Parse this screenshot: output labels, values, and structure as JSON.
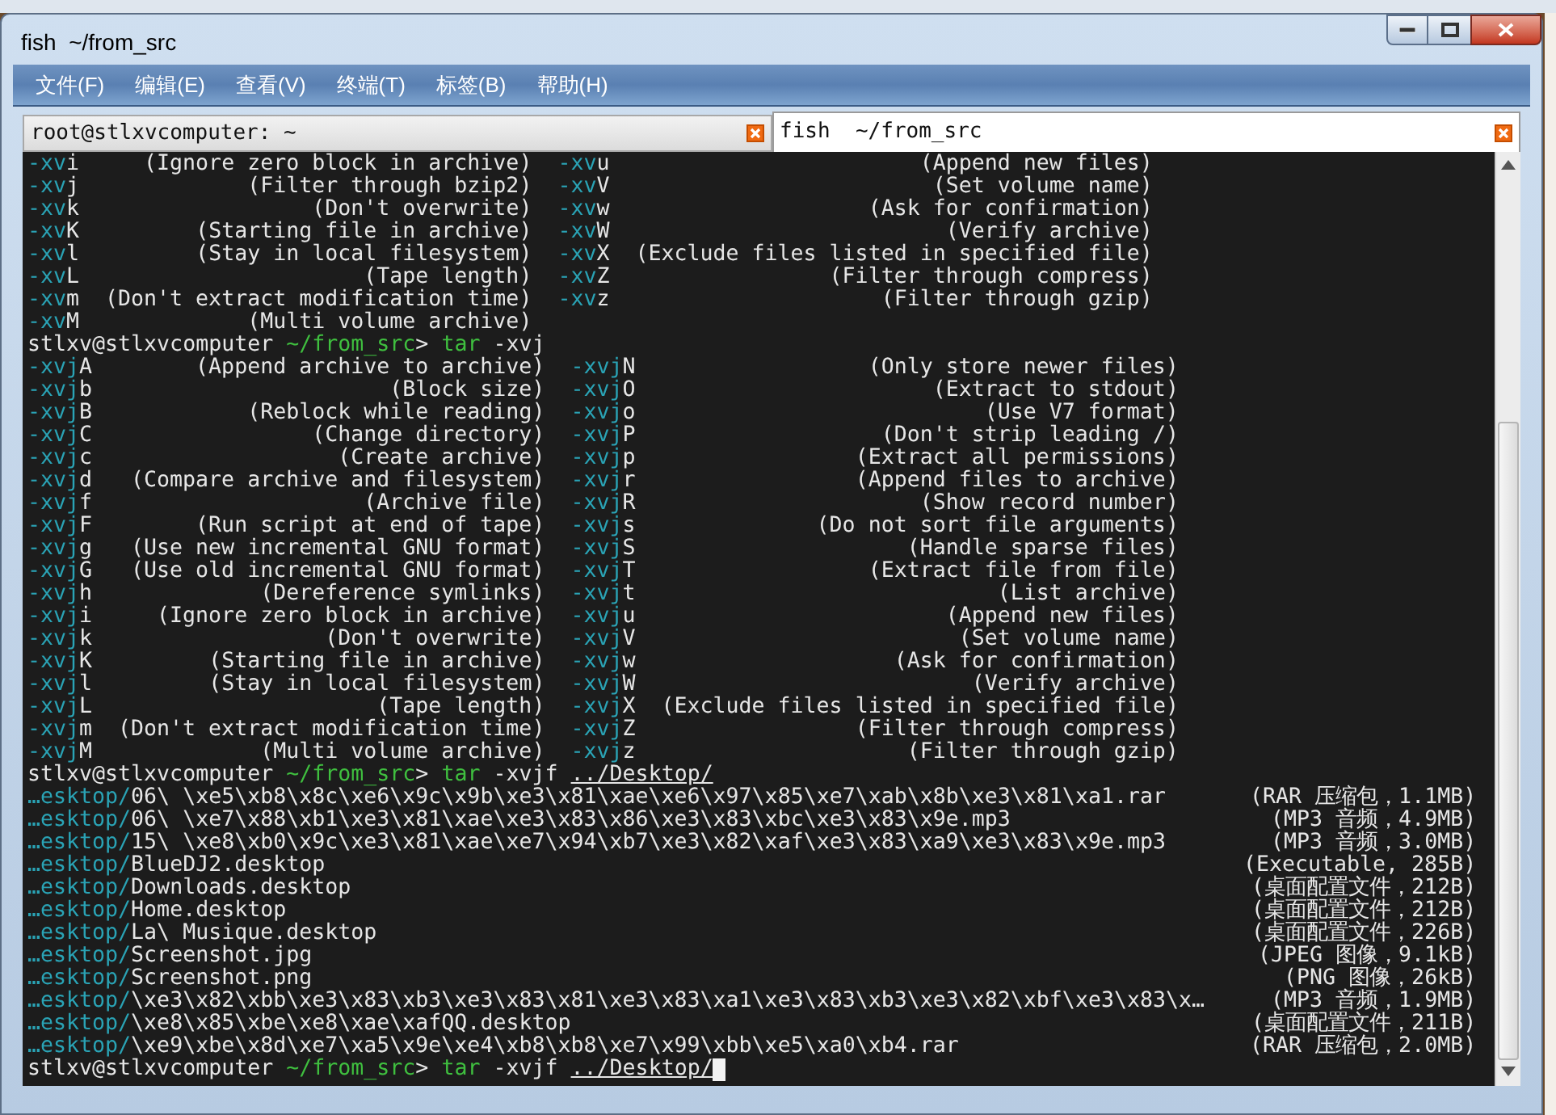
{
  "window": {
    "title": "fish  ~/from_src"
  },
  "menu": [
    {
      "label": "文件(F)"
    },
    {
      "label": "编辑(E)"
    },
    {
      "label": "查看(V)"
    },
    {
      "label": "终端(T)"
    },
    {
      "label": "标签(B)"
    },
    {
      "label": "帮助(H)"
    }
  ],
  "tabs": [
    {
      "label": "root@stlxvcomputer: ~",
      "selected": false
    },
    {
      "label": "fish  ~/from_src",
      "selected": true
    }
  ],
  "terminal": {
    "lines": [
      {
        "kind": "completion",
        "left": {
          "flag": "-xvi",
          "description": "(Ignore zero block in archive)"
        },
        "right": {
          "flag": "-xvu",
          "description": "(Append new files)"
        }
      },
      {
        "kind": "completion",
        "left": {
          "flag": "-xvj",
          "description": "(Filter through bzip2)"
        },
        "right": {
          "flag": "-xvV",
          "description": "(Set volume name)"
        }
      },
      {
        "kind": "completion",
        "left": {
          "flag": "-xvk",
          "description": "(Don't overwrite)"
        },
        "right": {
          "flag": "-xvw",
          "description": "(Ask for confirmation)"
        }
      },
      {
        "kind": "completion",
        "left": {
          "flag": "-xvK",
          "description": "(Starting file in archive)"
        },
        "right": {
          "flag": "-xvW",
          "description": "(Verify archive)"
        }
      },
      {
        "kind": "completion",
        "left": {
          "flag": "-xvl",
          "description": "(Stay in local filesystem)"
        },
        "right": {
          "flag": "-xvX",
          "description": "(Exclude files listed in specified file)"
        }
      },
      {
        "kind": "completion",
        "left": {
          "flag": "-xvL",
          "description": "(Tape length)"
        },
        "right": {
          "flag": "-xvZ",
          "description": "(Filter through compress)"
        }
      },
      {
        "kind": "completion",
        "left": {
          "flag": "-xvm",
          "description": "(Don't extract modification time)"
        },
        "right": {
          "flag": "-xvz",
          "description": "(Filter through gzip)"
        }
      },
      {
        "kind": "completion",
        "left": {
          "flag": "-xvM",
          "description": "(Multi volume archive)"
        }
      },
      {
        "kind": "prompt",
        "user_host": "stlxv@stlxvcomputer",
        "cwd": "~/from_src",
        "symbol": ">",
        "command": "tar",
        "args": "-xvj",
        "cursor": false
      },
      {
        "kind": "completion",
        "left": {
          "flag": "-xvjA",
          "description": "(Append archive to archive)"
        },
        "right": {
          "flag": "-xvjN",
          "description": "(Only store newer files)"
        }
      },
      {
        "kind": "completion",
        "left": {
          "flag": "-xvjb",
          "description": "(Block size)"
        },
        "right": {
          "flag": "-xvjO",
          "description": "(Extract to stdout)"
        }
      },
      {
        "kind": "completion",
        "left": {
          "flag": "-xvjB",
          "description": "(Reblock while reading)"
        },
        "right": {
          "flag": "-xvjo",
          "description": "(Use V7 format)"
        }
      },
      {
        "kind": "completion",
        "left": {
          "flag": "-xvjC",
          "description": "(Change directory)"
        },
        "right": {
          "flag": "-xvjP",
          "description": "(Don't strip leading /)"
        }
      },
      {
        "kind": "completion",
        "left": {
          "flag": "-xvjc",
          "description": "(Create archive)"
        },
        "right": {
          "flag": "-xvjp",
          "description": "(Extract all permissions)"
        }
      },
      {
        "kind": "completion",
        "left": {
          "flag": "-xvjd",
          "description": "(Compare archive and filesystem)"
        },
        "right": {
          "flag": "-xvjr",
          "description": "(Append files to archive)"
        }
      },
      {
        "kind": "completion",
        "left": {
          "flag": "-xvjf",
          "description": "(Archive file)"
        },
        "right": {
          "flag": "-xvjR",
          "description": "(Show record number)"
        }
      },
      {
        "kind": "completion",
        "left": {
          "flag": "-xvjF",
          "description": "(Run script at end of tape)"
        },
        "right": {
          "flag": "-xvjs",
          "description": "(Do not sort file arguments)"
        }
      },
      {
        "kind": "completion",
        "left": {
          "flag": "-xvjg",
          "description": "(Use new incremental GNU format)"
        },
        "right": {
          "flag": "-xvjS",
          "description": "(Handle sparse files)"
        }
      },
      {
        "kind": "completion",
        "left": {
          "flag": "-xvjG",
          "description": "(Use old incremental GNU format)"
        },
        "right": {
          "flag": "-xvjT",
          "description": "(Extract file from file)"
        }
      },
      {
        "kind": "completion",
        "left": {
          "flag": "-xvjh",
          "description": "(Dereference symlinks)"
        },
        "right": {
          "flag": "-xvjt",
          "description": "(List archive)"
        }
      },
      {
        "kind": "completion",
        "left": {
          "flag": "-xvji",
          "description": "(Ignore zero block in archive)"
        },
        "right": {
          "flag": "-xvju",
          "description": "(Append new files)"
        }
      },
      {
        "kind": "completion",
        "left": {
          "flag": "-xvjk",
          "description": "(Don't overwrite)"
        },
        "right": {
          "flag": "-xvjV",
          "description": "(Set volume name)"
        }
      },
      {
        "kind": "completion",
        "left": {
          "flag": "-xvjK",
          "description": "(Starting file in archive)"
        },
        "right": {
          "flag": "-xvjw",
          "description": "(Ask for confirmation)"
        }
      },
      {
        "kind": "completion",
        "left": {
          "flag": "-xvjl",
          "description": "(Stay in local filesystem)"
        },
        "right": {
          "flag": "-xvjW",
          "description": "(Verify archive)"
        }
      },
      {
        "kind": "completion",
        "left": {
          "flag": "-xvjL",
          "description": "(Tape length)"
        },
        "right": {
          "flag": "-xvjX",
          "description": "(Exclude files listed in specified file)"
        }
      },
      {
        "kind": "completion",
        "left": {
          "flag": "-xvjm",
          "description": "(Don't extract modification time)"
        },
        "right": {
          "flag": "-xvjZ",
          "description": "(Filter through compress)"
        }
      },
      {
        "kind": "completion",
        "left": {
          "flag": "-xvjM",
          "description": "(Multi volume archive)"
        },
        "right": {
          "flag": "-xvjz",
          "description": "(Filter through gzip)"
        }
      },
      {
        "kind": "prompt",
        "user_host": "stlxv@stlxvcomputer",
        "cwd": "~/from_src",
        "symbol": ">",
        "command": "tar",
        "args": "-xvjf",
        "path_arg": "../Desktop/",
        "cursor": false
      },
      {
        "kind": "file",
        "prefix": "…esktop/",
        "name": "06\\ \\xe5\\xb8\\x8c\\xe6\\x9c\\x9b\\xe3\\x81\\xae\\xe6\\x97\\x85\\xe7\\xab\\x8b\\xe3\\x81\\xa1.rar",
        "description": "(RAR 压缩包，1.1MB)"
      },
      {
        "kind": "file",
        "prefix": "…esktop/",
        "name": "06\\ \\xe7\\x88\\xb1\\xe3\\x81\\xae\\xe3\\x83\\x86\\xe3\\x83\\xbc\\xe3\\x83\\x9e.mp3",
        "description": "(MP3 音频，4.9MB)"
      },
      {
        "kind": "file",
        "prefix": "…esktop/",
        "name": "15\\ \\xe8\\xb0\\x9c\\xe3\\x81\\xae\\xe7\\x94\\xb7\\xe3\\x82\\xaf\\xe3\\x83\\xa9\\xe3\\x83\\x9e.mp3",
        "description": "(MP3 音频，3.0MB)"
      },
      {
        "kind": "file",
        "prefix": "…esktop/",
        "name": "BlueDJ2.desktop",
        "description": "(Executable, 285B)"
      },
      {
        "kind": "file",
        "prefix": "…esktop/",
        "name": "Downloads.desktop",
        "description": "(桌面配置文件，212B)"
      },
      {
        "kind": "file",
        "prefix": "…esktop/",
        "name": "Home.desktop",
        "description": "(桌面配置文件，212B)"
      },
      {
        "kind": "file",
        "prefix": "…esktop/",
        "name": "La\\ Musique.desktop",
        "description": "(桌面配置文件，226B)"
      },
      {
        "kind": "file",
        "prefix": "…esktop/",
        "name": "Screenshot.jpg",
        "description": "(JPEG 图像，9.1kB)"
      },
      {
        "kind": "file",
        "prefix": "…esktop/",
        "name": "Screenshot.png",
        "description": "(PNG 图像，26kB)"
      },
      {
        "kind": "file",
        "prefix": "…esktop/",
        "name": "\\xe3\\x82\\xbb\\xe3\\x83\\xb3\\xe3\\x83\\x81\\xe3\\x83\\xa1\\xe3\\x83\\xb3\\xe3\\x82\\xbf\\xe3\\x83\\x…",
        "description": "(MP3 音频，1.9MB)"
      },
      {
        "kind": "file",
        "prefix": "…esktop/",
        "name": "\\xe8\\x85\\xbe\\xe8\\xae\\xafQQ.desktop",
        "description": "(桌面配置文件，211B)"
      },
      {
        "kind": "file",
        "prefix": "…esktop/",
        "name": "\\xe9\\xbe\\x8d\\xe7\\xa5\\x9e\\xe4\\xb8\\xb8\\xe7\\x99\\xbb\\xe5\\xa0\\xb4.rar",
        "description": "(RAR 压缩包，2.0MB)"
      },
      {
        "kind": "prompt",
        "user_host": "stlxv@stlxvcomputer",
        "cwd": "~/from_src",
        "symbol": ">",
        "command": "tar",
        "args": "-xvjf",
        "path_arg": "../Desktop/",
        "cursor": true
      }
    ]
  }
}
